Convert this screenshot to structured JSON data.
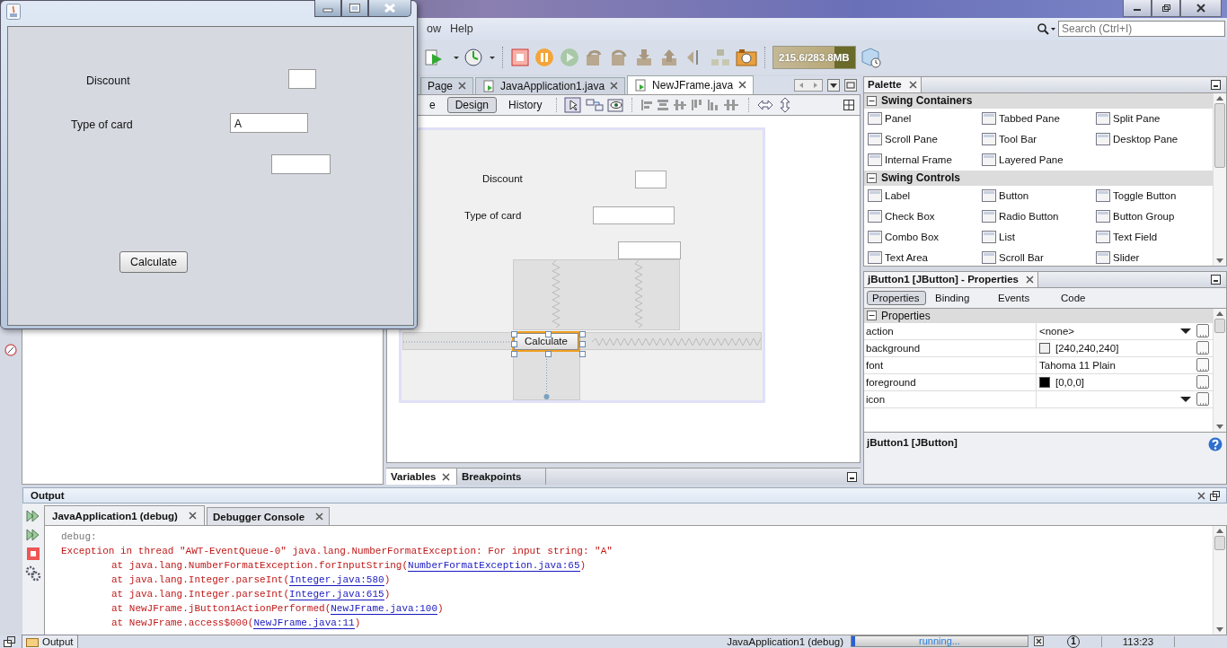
{
  "ide": {
    "menu": [
      "ow",
      "Help"
    ],
    "search": {
      "placeholder": "Search (Ctrl+I)"
    },
    "memory": "215.6/283.8MB"
  },
  "editor": {
    "tabs": [
      {
        "label": "Page",
        "selected": false
      },
      {
        "label": "JavaApplication1.java",
        "selected": false
      },
      {
        "label": "NewJFrame.java",
        "selected": true
      }
    ],
    "views": [
      {
        "label": "e",
        "selected": false
      },
      {
        "label": "Design",
        "selected": true
      },
      {
        "label": "History",
        "selected": false
      }
    ],
    "form": {
      "discount_label": "Discount",
      "card_label": "Type of card",
      "button": "Calculate"
    }
  },
  "debug_tabs": [
    {
      "label": "Variables",
      "selected": true
    },
    {
      "label": "Breakpoints",
      "selected": false
    }
  ],
  "palette": {
    "title": "Palette",
    "sections": [
      {
        "name": "Swing Containers",
        "expanded": true,
        "items": [
          "Panel",
          "Tabbed Pane",
          "Split Pane",
          "Scroll Pane",
          "Tool Bar",
          "Desktop Pane",
          "Internal Frame",
          "Layered Pane"
        ]
      },
      {
        "name": "Swing Controls",
        "expanded": true,
        "items": [
          "Label",
          "Button",
          "Toggle Button",
          "Check Box",
          "Radio Button",
          "Button Group",
          "Combo Box",
          "List",
          "Text Field",
          "Text Area",
          "Scroll Bar",
          "Slider"
        ]
      }
    ]
  },
  "properties": {
    "title": "jButton1 [JButton] - Properties",
    "tabs": [
      {
        "label": "Properties",
        "selected": true
      },
      {
        "label": "Binding",
        "selected": false
      },
      {
        "label": "Events",
        "selected": false
      },
      {
        "label": "Code",
        "selected": false
      }
    ],
    "section": "Properties",
    "rows": [
      {
        "name": "action",
        "value": "<none>",
        "kind": "combo"
      },
      {
        "name": "background",
        "value": "[240,240,240]",
        "kind": "color",
        "color": "#f0f0f0"
      },
      {
        "name": "font",
        "value": "Tahoma 11 Plain",
        "kind": "text"
      },
      {
        "name": "foreground",
        "value": "[0,0,0]",
        "kind": "color",
        "color": "#000000"
      },
      {
        "name": "icon",
        "kind": "combo"
      }
    ],
    "footer": "jButton1 [JButton]"
  },
  "output": {
    "title": "Output",
    "tabs": [
      {
        "label": "JavaApplication1 (debug)",
        "selected": true
      },
      {
        "label": "Debugger Console",
        "selected": false
      }
    ],
    "lines": [
      {
        "kind": "info",
        "text": "debug:"
      },
      {
        "kind": "error",
        "text": "Exception in thread \"AWT-EventQueue-0\" java.lang.NumberFormatException: For input string: \"A\""
      },
      {
        "kind": "trace",
        "text": "at java.lang.NumberFormatException.forInputString(",
        "link": "NumberFormatException.java:65",
        "end": ")"
      },
      {
        "kind": "trace",
        "text": "at java.lang.Integer.parseInt(",
        "link": "Integer.java:580",
        "end": ")"
      },
      {
        "kind": "trace",
        "text": "at java.lang.Integer.parseInt(",
        "link": "Integer.java:615",
        "end": ")"
      },
      {
        "kind": "trace",
        "text": "at NewJFrame.jButton1ActionPerformed(",
        "link": "NewJFrame.java:100",
        "end": ")"
      },
      {
        "kind": "trace",
        "text": "at NewJFrame.access$000(",
        "link": "NewJFrame.java:11",
        "end": ")"
      }
    ]
  },
  "status": {
    "tab": "Output",
    "task": "JavaApplication1 (debug)",
    "progress": "running...",
    "level": 0.02,
    "notifications": "1",
    "position": "113:23"
  },
  "app_window": {
    "discount_label": "Discount",
    "card_label": "Type of card",
    "card_value": "A",
    "button": "Calculate"
  }
}
